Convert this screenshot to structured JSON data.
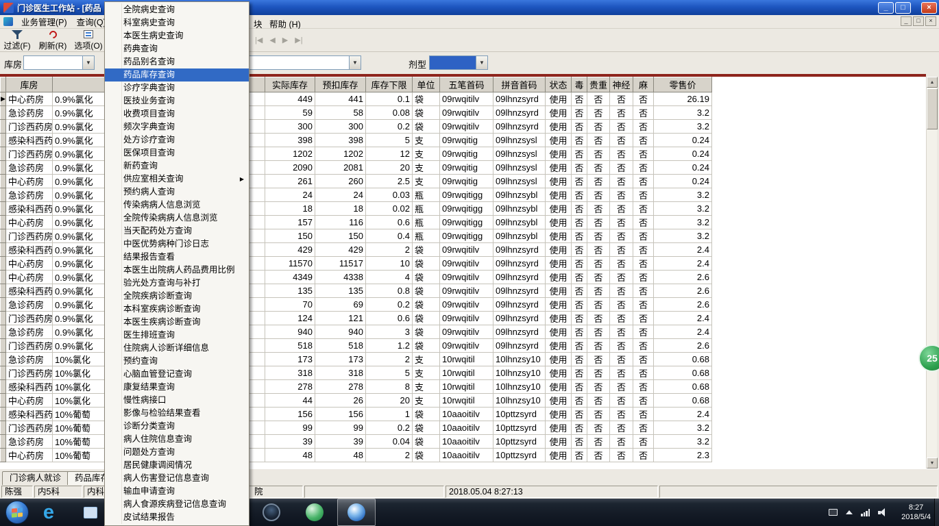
{
  "window": {
    "title": "门诊医生工作站 - [药品",
    "controls": {
      "min": "_",
      "restore": "□",
      "close": "×"
    }
  },
  "menu_bar": {
    "business": "业务管理(P)",
    "query": "查询(Q)",
    "fragment": "块",
    "help": "帮助 (H)"
  },
  "toolbar": {
    "filter": "过滤(F)",
    "refresh": "刷新(R)",
    "options": "选项(O)",
    "nav": {
      "first": "|◀",
      "prev": "◀",
      "next": "▶",
      "last": "▶|"
    }
  },
  "filter_bar": {
    "warehouse_label": "库房",
    "dosage_label": "剂型"
  },
  "icons": {
    "dropdown": "▼",
    "up": "▲",
    "down": "▼",
    "submenu": "▶"
  },
  "query_menu": {
    "items": [
      "全院病史查询",
      "科室病史查询",
      "本医生病史查询",
      "药典查询",
      "药品别名查询",
      "药品库存查询",
      "诊疗字典查询",
      "医技业务查询",
      "收费项目查询",
      "频次字典查询",
      "处方诊疗查询",
      "医保项目查询",
      "新药查询",
      "供应室相关查询",
      "预约病人查询",
      "传染病病人信息浏览",
      "全院传染病病人信息浏览",
      "当天配药处方查询",
      "中医优势病种门诊日志",
      "结果报告查看",
      "本医生出院病人药品费用比例",
      "验光处方查询与补打",
      "全院疾病诊断查询",
      "本科室疾病诊断查询",
      "本医生疾病诊断查询",
      "医生排班查询",
      "住院病人诊断详细信息",
      "预约查询",
      "心脑血管登记查询",
      "康复结果查询",
      "慢性病接口",
      "影像与检验结果查看",
      "诊断分类查询",
      "病人住院信息查询",
      "问题处方查询",
      "居民健康调阅情况",
      "病人伤害登记信息查询",
      "输血申请查询",
      "病人食源疾病登记信息查询",
      "皮试结果报告"
    ],
    "selected_index": 5,
    "submenu_index": 13
  },
  "table": {
    "headers": [
      "库房",
      "实际库存",
      "预扣库存",
      "库存下限",
      "单位",
      "五笔首码",
      "拼音首码",
      "状态",
      "毒",
      "贵重",
      "神经",
      "麻",
      "零售价"
    ],
    "row_indicator": "▶",
    "rows": [
      [
        "中心药房",
        "0.9%氯化",
        "449",
        "441",
        "0.1",
        "袋",
        "09rwqitilv",
        "09lhnzsyrd",
        "使用",
        "否",
        "否",
        "否",
        "否",
        "26.19"
      ],
      [
        "急诊药房",
        "0.9%氯化",
        "59",
        "58",
        "0.08",
        "袋",
        "09rwqitilv",
        "09lhnzsyrd",
        "使用",
        "否",
        "否",
        "否",
        "否",
        "3.2"
      ],
      [
        "门诊西药房",
        "0.9%氯化",
        "300",
        "300",
        "0.2",
        "袋",
        "09rwqitilv",
        "09lhnzsyrd",
        "使用",
        "否",
        "否",
        "否",
        "否",
        "3.2"
      ],
      [
        "感染科西药",
        "0.9%氯化",
        "398",
        "398",
        "5",
        "支",
        "09rwqitig",
        "09lhnzsysl",
        "使用",
        "否",
        "否",
        "否",
        "否",
        "0.24"
      ],
      [
        "门诊西药房",
        "0.9%氯化",
        "1202",
        "1202",
        "12",
        "支",
        "09rwqitig",
        "09lhnzsysl",
        "使用",
        "否",
        "否",
        "否",
        "否",
        "0.24"
      ],
      [
        "急诊药房",
        "0.9%氯化",
        "2090",
        "2081",
        "20",
        "支",
        "09rwqitig",
        "09lhnzsysl",
        "使用",
        "否",
        "否",
        "否",
        "否",
        "0.24"
      ],
      [
        "中心药房",
        "0.9%氯化",
        "261",
        "260",
        "2.5",
        "支",
        "09rwqitig",
        "09lhnzsysl",
        "使用",
        "否",
        "否",
        "否",
        "否",
        "0.24"
      ],
      [
        "急诊药房",
        "0.9%氯化",
        "24",
        "24",
        "0.03",
        "瓶",
        "09rwqitigg",
        "09lhnzsybl",
        "使用",
        "否",
        "否",
        "否",
        "否",
        "3.2"
      ],
      [
        "感染科西药",
        "0.9%氯化",
        "18",
        "18",
        "0.02",
        "瓶",
        "09rwqitigg",
        "09lhnzsybl",
        "使用",
        "否",
        "否",
        "否",
        "否",
        "3.2"
      ],
      [
        "中心药房",
        "0.9%氯化",
        "157",
        "116",
        "0.6",
        "瓶",
        "09rwqitigg",
        "09lhnzsybl",
        "使用",
        "否",
        "否",
        "否",
        "否",
        "3.2"
      ],
      [
        "门诊西药房",
        "0.9%氯化",
        "150",
        "150",
        "0.4",
        "瓶",
        "09rwqitigg",
        "09lhnzsybl",
        "使用",
        "否",
        "否",
        "否",
        "否",
        "3.2"
      ],
      [
        "感染科西药",
        "0.9%氯化",
        "429",
        "429",
        "2",
        "袋",
        "09rwqitilv",
        "09lhnzsyrd",
        "使用",
        "否",
        "否",
        "否",
        "否",
        "2.4"
      ],
      [
        "中心药房",
        "0.9%氯化",
        "11570",
        "11517",
        "10",
        "袋",
        "09rwqitilv",
        "09lhnzsyrd",
        "使用",
        "否",
        "否",
        "否",
        "否",
        "2.4"
      ],
      [
        "中心药房",
        "0.9%氯化",
        "4349",
        "4338",
        "4",
        "袋",
        "09rwqitilv",
        "09lhnzsyrd",
        "使用",
        "否",
        "否",
        "否",
        "否",
        "2.6"
      ],
      [
        "感染科西药",
        "0.9%氯化",
        "135",
        "135",
        "0.8",
        "袋",
        "09rwqitilv",
        "09lhnzsyrd",
        "使用",
        "否",
        "否",
        "否",
        "否",
        "2.6"
      ],
      [
        "急诊药房",
        "0.9%氯化",
        "70",
        "69",
        "0.2",
        "袋",
        "09rwqitilv",
        "09lhnzsyrd",
        "使用",
        "否",
        "否",
        "否",
        "否",
        "2.6"
      ],
      [
        "门诊西药房",
        "0.9%氯化",
        "124",
        "121",
        "0.6",
        "袋",
        "09rwqitilv",
        "09lhnzsyrd",
        "使用",
        "否",
        "否",
        "否",
        "否",
        "2.4"
      ],
      [
        "急诊药房",
        "0.9%氯化",
        "940",
        "940",
        "3",
        "袋",
        "09rwqitilv",
        "09lhnzsyrd",
        "使用",
        "否",
        "否",
        "否",
        "否",
        "2.4"
      ],
      [
        "门诊西药房",
        "0.9%氯化",
        "518",
        "518",
        "1.2",
        "袋",
        "09rwqitilv",
        "09lhnzsyrd",
        "使用",
        "否",
        "否",
        "否",
        "否",
        "2.6"
      ],
      [
        "急诊药房",
        "10%氯化",
        "173",
        "173",
        "2",
        "支",
        "10rwqitil",
        "10lhnzsy10",
        "使用",
        "否",
        "否",
        "否",
        "否",
        "0.68"
      ],
      [
        "门诊西药房",
        "10%氯化",
        "318",
        "318",
        "5",
        "支",
        "10rwqitil",
        "10lhnzsy10",
        "使用",
        "否",
        "否",
        "否",
        "否",
        "0.68"
      ],
      [
        "感染科西药",
        "10%氯化",
        "278",
        "278",
        "8",
        "支",
        "10rwqitil",
        "10lhnzsy10",
        "使用",
        "否",
        "否",
        "否",
        "否",
        "0.68"
      ],
      [
        "中心药房",
        "10%氯化",
        "44",
        "26",
        "20",
        "支",
        "10rwqitil",
        "10lhnzsy10",
        "使用",
        "否",
        "否",
        "否",
        "否",
        "0.68"
      ],
      [
        "感染科西药",
        "10%葡萄",
        "156",
        "156",
        "1",
        "袋",
        "10aaoitilv",
        "10pttzsyrd",
        "使用",
        "否",
        "否",
        "否",
        "否",
        "2.4"
      ],
      [
        "门诊西药房",
        "10%葡萄",
        "99",
        "99",
        "0.2",
        "袋",
        "10aaoitilv",
        "10pttzsyrd",
        "使用",
        "否",
        "否",
        "否",
        "否",
        "3.2"
      ],
      [
        "急诊药房",
        "10%葡萄",
        "39",
        "39",
        "0.04",
        "袋",
        "10aaoitilv",
        "10pttzsyrd",
        "使用",
        "否",
        "否",
        "否",
        "否",
        "3.2"
      ],
      [
        "中心药房",
        "10%葡萄",
        "48",
        "48",
        "2",
        "袋",
        "10aaoitilv",
        "10pttzsyrd",
        "使用",
        "否",
        "否",
        "否",
        "否",
        "2.3"
      ]
    ]
  },
  "bottom_tabs": {
    "tab1": "门诊病人就诊",
    "tab2": "药品库存"
  },
  "status_bar": {
    "user": "陈强",
    "dept": "内5科",
    "seg3": "内科",
    "seg3_tail": "院",
    "datetime": "2018.05.04 8:27:13"
  },
  "taskbar": {
    "time": "8:27",
    "date": "2018/5/4",
    "edge_glyph": "e"
  },
  "float_badge": "25"
}
